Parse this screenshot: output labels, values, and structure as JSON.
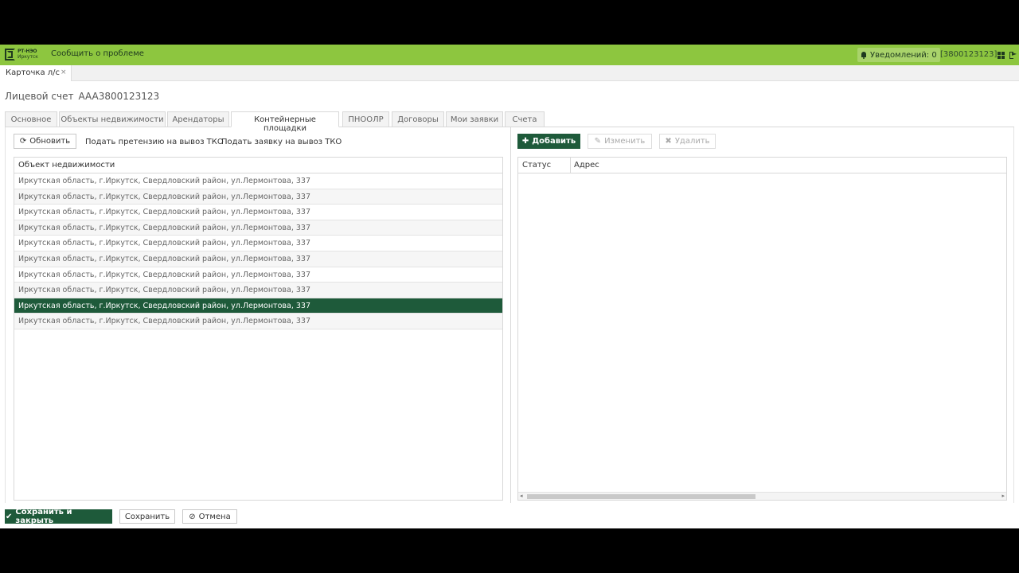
{
  "topbar": {
    "logo_line1": "РТ-НЭО",
    "logo_line2": "Иркутск",
    "report_problem": "Сообщить о проблеме",
    "notifications": "Уведомлений: 0",
    "account_id": "[3800123123]",
    "icons": [
      "bell-icon",
      "grid-icon",
      "exit-icon"
    ]
  },
  "window_tab": {
    "label": "Карточка л/с",
    "close": "×"
  },
  "header": {
    "label": "Лицевой счет",
    "number": "AAA3800123123"
  },
  "tabs": [
    {
      "label": "Основное"
    },
    {
      "label": "Объекты недвижимости"
    },
    {
      "label": "Арендаторы"
    },
    {
      "label": "Контейнерные площадки"
    },
    {
      "label": "ПНООЛР"
    },
    {
      "label": "Договоры"
    },
    {
      "label": "Мои заявки"
    },
    {
      "label": "Счета"
    }
  ],
  "active_tab": "Контейнерные площадки",
  "left_toolbar": {
    "refresh": "Обновить",
    "claim": "Подать претензию на вывоз ТКО",
    "request": "Подать заявку на вывоз ТКО"
  },
  "left_table": {
    "header": "Объект недвижимости",
    "rows": [
      "Иркутская область, г.Иркутск, Свердловский район, ул.Лермонтова, 337",
      "Иркутская область, г.Иркутск, Свердловский район, ул.Лермонтова, 337",
      "Иркутская область, г.Иркутск, Свердловский район, ул.Лермонтова, 337",
      "Иркутская область, г.Иркутск, Свердловский район, ул.Лермонтова, 337",
      "Иркутская область, г.Иркутск, Свердловский район, ул.Лермонтова, 337",
      "Иркутская область, г.Иркутск, Свердловский район, ул.Лермонтова, 337",
      "Иркутская область, г.Иркутск, Свердловский район, ул.Лермонтова, 337",
      "Иркутская область, г.Иркутск, Свердловский район, ул.Лермонтова, 337",
      "Иркутская область, г.Иркутск, Свердловский район, ул.Лермонтова, 337",
      "Иркутская область, г.Иркутск, Свердловский район, ул.Лермонтова, 337"
    ],
    "selected_index": 8
  },
  "right_toolbar": {
    "add": "Добавить",
    "edit": "Изменить",
    "delete": "Удалить"
  },
  "right_table": {
    "col_status": "Статус",
    "col_address": "Адрес"
  },
  "footer": {
    "save_close": "Сохранить и закрыть",
    "save": "Сохранить",
    "cancel": "Отмена"
  },
  "colors": {
    "topbar": "#8dc63f",
    "primary": "#1e5a3a"
  }
}
